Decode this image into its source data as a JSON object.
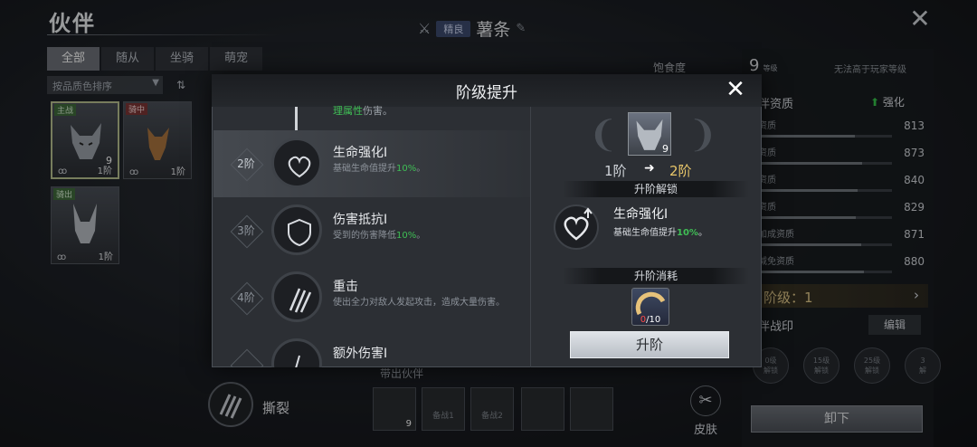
{
  "page": {
    "title": "伙伴"
  },
  "hero": {
    "badge": "精良",
    "name": "薯条"
  },
  "filter_tabs": [
    "全部",
    "随从",
    "坐骑",
    "萌宠"
  ],
  "sort": {
    "label": "按品质色排序",
    "toggle": "⇅"
  },
  "partners": [
    {
      "tag": "主战",
      "level": "9",
      "rank": "1阶",
      "type_icon": "wolf",
      "color": "#3f6a3b"
    },
    {
      "tag": "骑中",
      "level": "",
      "rank": "1阶",
      "type_icon": "deer",
      "color": "#7b3535"
    },
    {
      "tag": "骑出",
      "level": "",
      "rank": "1阶",
      "type_icon": "rabbit",
      "color": "#3f6a3b"
    }
  ],
  "satiety": {
    "label": "饱食度"
  },
  "right_panel": {
    "level": "9",
    "level_unit": "等级",
    "note": "无法高于玩家等级",
    "attr_title": "伴资质",
    "strength_label": "强化",
    "stats": [
      {
        "label": "资质",
        "value": "813",
        "fill": 0.72
      },
      {
        "label": "资质",
        "value": "873",
        "fill": 0.78
      },
      {
        "label": "资质",
        "value": "840",
        "fill": 0.74
      },
      {
        "label": "资质",
        "value": "829",
        "fill": 0.73
      },
      {
        "label": "加成资质",
        "value": "871",
        "fill": 0.77
      },
      {
        "label": "减免资质",
        "value": "880",
        "fill": 0.79
      }
    ],
    "rank_text": "阶级：1",
    "seal_title": "伴战印",
    "edit_label": "编辑",
    "seals": [
      "0级\n解锁",
      "15级\n解锁",
      "25级\n解锁",
      "3\n解"
    ],
    "unequip_label": "卸下"
  },
  "bottom": {
    "skill_label": "撕裂",
    "bring_out_label": "带出伙伴",
    "team_slots": [
      {
        "caption": "",
        "level": "9"
      },
      {
        "caption": "备战1",
        "level": ""
      },
      {
        "caption": "备战2",
        "level": ""
      },
      {
        "caption": "",
        "level": ""
      },
      {
        "caption": "",
        "level": ""
      }
    ],
    "skin_label": "皮肤"
  },
  "modal": {
    "title": "阶级提升",
    "partial_top": {
      "highlight": "理属性",
      "rest": "伤害。"
    },
    "tiers": [
      {
        "rank": "2阶",
        "name": "生命强化I",
        "desc_pre": "基础生命值提升",
        "desc_hi": "10%",
        "desc_post": "。",
        "active": true
      },
      {
        "rank": "3阶",
        "name": "伤害抵抗I",
        "desc_pre": "受到的伤害降低",
        "desc_hi": "10%",
        "desc_post": "。",
        "active": false
      },
      {
        "rank": "4阶",
        "name": "重击",
        "desc_pre": "使出全力对敌人发起攻击，造成大量伤害。",
        "desc_hi": "",
        "desc_post": "",
        "active": false
      },
      {
        "rank": "",
        "name": "额外伤害I",
        "desc_pre": "",
        "desc_hi": "",
        "desc_post": "",
        "active": false
      }
    ],
    "unit_level": "9",
    "rank_from": "1阶",
    "rank_arrow": "➜",
    "rank_to": "2阶",
    "unlock_section": "升阶解锁",
    "unlock_name": "生命强化I",
    "unlock_desc_pre": "基础生命值提升",
    "unlock_desc_hi": "10%",
    "unlock_desc_post": "。",
    "cost_section": "升阶消耗",
    "cost_have": "0",
    "cost_need": "/10",
    "upgrade_label": "升阶"
  },
  "colors": {
    "highlight_green": "#3fbf55",
    "gold": "#e8c66a",
    "missing_red": "#ff4b4b"
  }
}
